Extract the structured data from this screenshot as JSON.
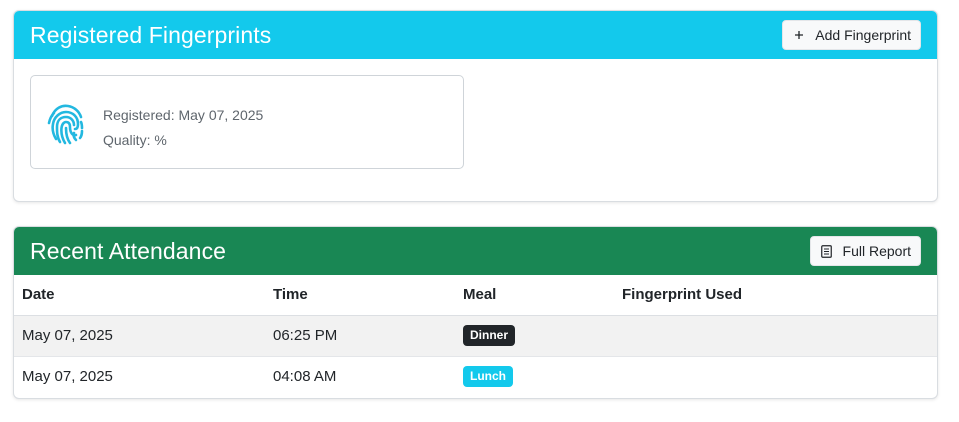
{
  "fingerprints": {
    "title": "Registered Fingerprints",
    "add_button_label": "Add Fingerprint",
    "add_button_icon": "plus-icon",
    "header_color": "#13c9ec",
    "items": [
      {
        "icon": "fingerprint-icon",
        "registered": "Registered: May 07, 2025",
        "quality": "Quality: %"
      }
    ]
  },
  "attendance": {
    "title": "Recent Attendance",
    "report_button_label": "Full Report",
    "report_button_icon": "document-icon",
    "header_color": "#198754",
    "columns": [
      "Date",
      "Time",
      "Meal",
      "Fingerprint Used"
    ],
    "rows": [
      {
        "date": "May 07, 2025",
        "time": "06:25 PM",
        "meal": "Dinner",
        "meal_color": "#212529",
        "fingerprint": ""
      },
      {
        "date": "May 07, 2025",
        "time": "04:08 AM",
        "meal": "Lunch",
        "meal_color": "#13c9ec",
        "fingerprint": ""
      }
    ]
  }
}
